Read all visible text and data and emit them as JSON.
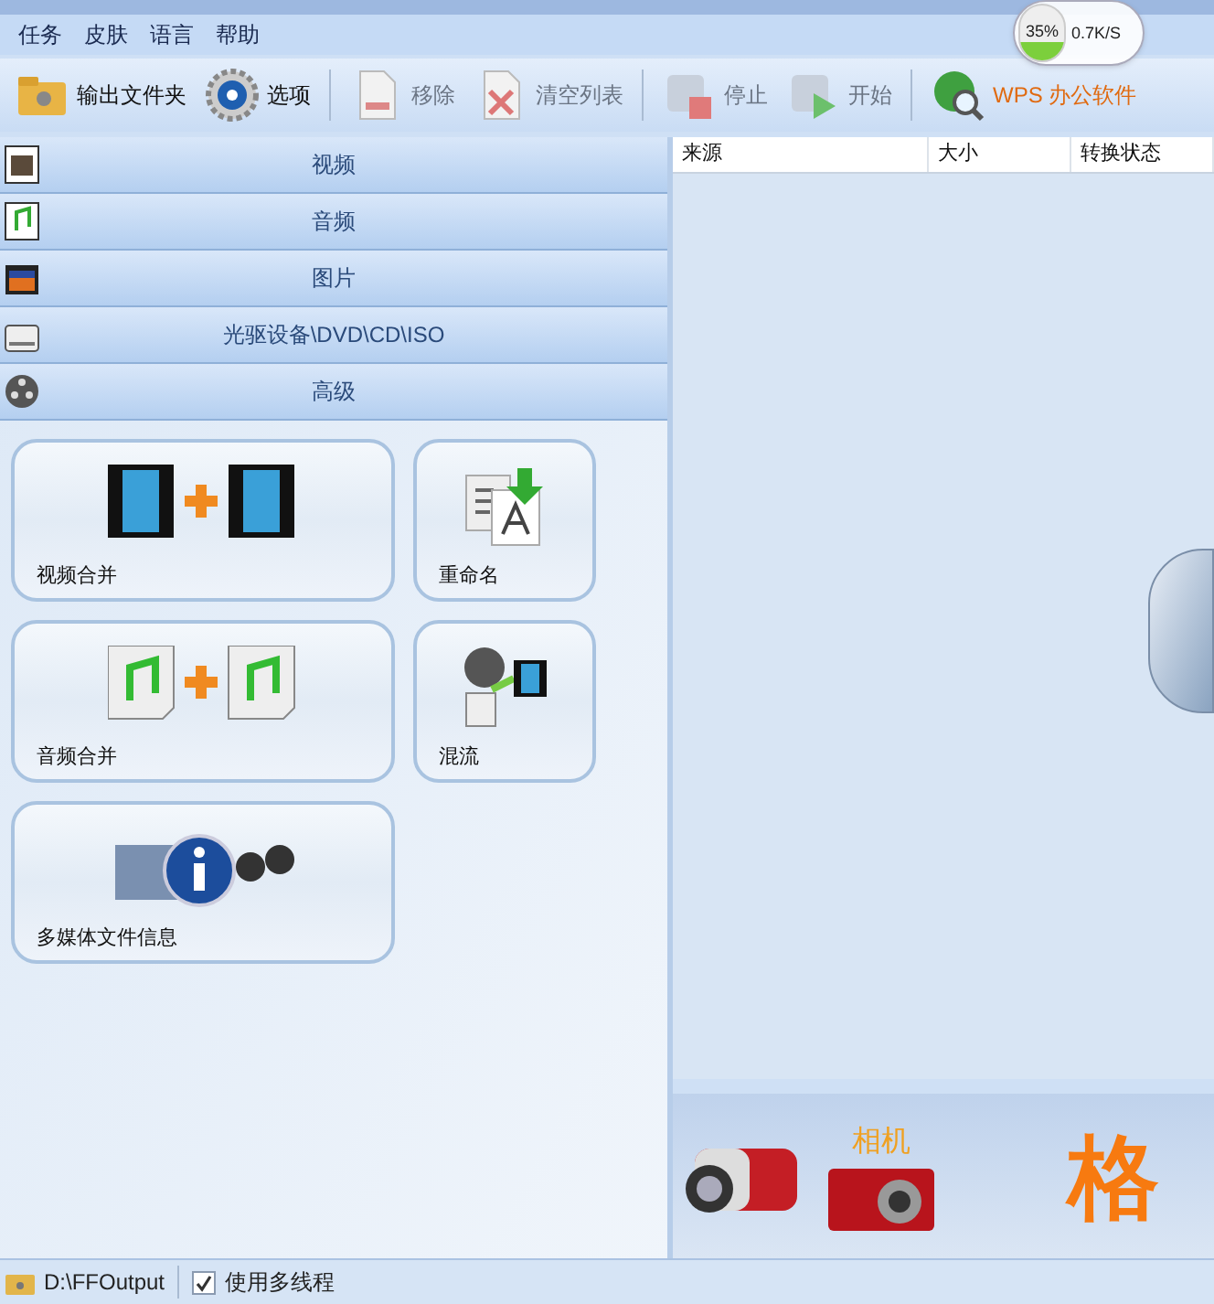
{
  "menu": [
    "任务",
    "皮肤",
    "语言",
    "帮助"
  ],
  "net_widget": {
    "percent": "35%",
    "down": "0.7K/S",
    "level": 0.35
  },
  "toolbar": [
    {
      "kind": "folder",
      "label": "输出文件夹",
      "disabled": false
    },
    {
      "kind": "gear",
      "label": "选项",
      "disabled": false
    },
    {
      "kind": "remove",
      "label": "移除",
      "disabled": true
    },
    {
      "kind": "clear",
      "label": "清空列表",
      "disabled": true
    },
    {
      "kind": "stop",
      "label": "停止",
      "disabled": true
    },
    {
      "kind": "start",
      "label": "开始",
      "disabled": true
    },
    {
      "kind": "globe",
      "label": "WPS 办公软件",
      "disabled": false
    }
  ],
  "categories": [
    {
      "kind": "video",
      "label": "视频"
    },
    {
      "kind": "audio",
      "label": "音频"
    },
    {
      "kind": "picture",
      "label": "图片"
    },
    {
      "kind": "disc",
      "label": "光驱设备\\DVD\\CD\\ISO"
    },
    {
      "kind": "advanced",
      "label": "高级"
    }
  ],
  "tools": [
    {
      "kind": "video-merge",
      "label": "视频合并"
    },
    {
      "kind": "rename",
      "label": "重命名"
    },
    {
      "kind": "audio-merge",
      "label": "音频合并"
    },
    {
      "kind": "mux",
      "label": "混流"
    },
    {
      "kind": "info",
      "label": "多媒体文件信息"
    }
  ],
  "table": {
    "columns": [
      "来源",
      "大小",
      "转换状态"
    ]
  },
  "banner": {
    "camera_label": "相机",
    "title": "格"
  },
  "status_bar": {
    "path": "D:\\FFOutput",
    "multithread": {
      "label": "使用多线程",
      "checked": true
    }
  }
}
